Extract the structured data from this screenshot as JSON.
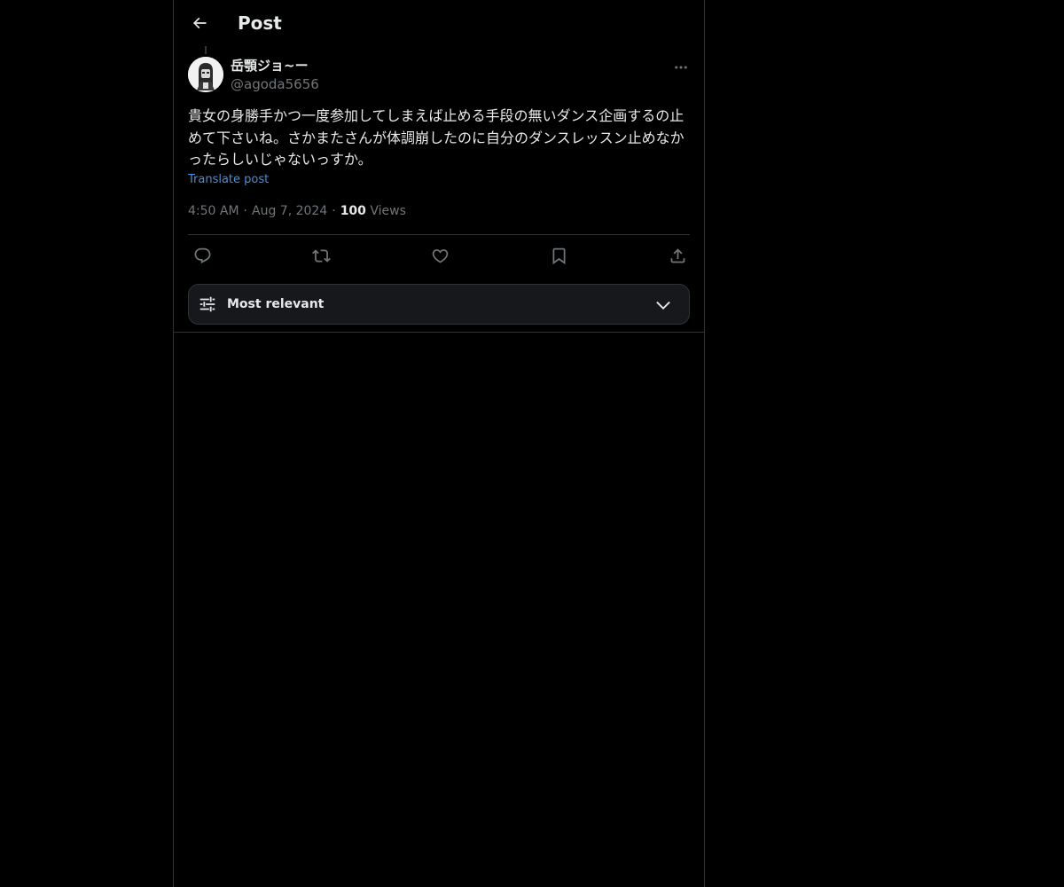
{
  "header": {
    "title": "Post",
    "back_icon": "arrow-left-icon"
  },
  "post": {
    "author": {
      "display_name": "岳顎ジョ~ー",
      "handle": "@agoda5656",
      "avatar_icon": "avatar"
    },
    "text": "貴女の身勝手かつ一度参加してしまえば止める手段の無いダンス企画するの止めて下さいね。さかまたさんが体調崩したのに自分のダンスレッスン止めなかったらしいじゃないっすか。",
    "translate_label": "Translate post",
    "time": "4:50 AM",
    "date": "Aug 7, 2024",
    "views_count": "100",
    "views_label": "Views",
    "separator": "·"
  },
  "actions": [
    {
      "name": "reply",
      "icon": "reply-icon"
    },
    {
      "name": "repost",
      "icon": "repost-icon"
    },
    {
      "name": "like",
      "icon": "heart-icon"
    },
    {
      "name": "bookmark",
      "icon": "bookmark-icon"
    },
    {
      "name": "share",
      "icon": "share-icon"
    }
  ],
  "sort": {
    "label": "Most relevant",
    "icon": "sliders-icon",
    "chevron": "chevron-down-icon"
  },
  "colors": {
    "background": "#000000",
    "text_primary": "#e7e9ea",
    "text_secondary": "#71767b",
    "link": "#4a8fd9",
    "border": "#2f3336"
  }
}
